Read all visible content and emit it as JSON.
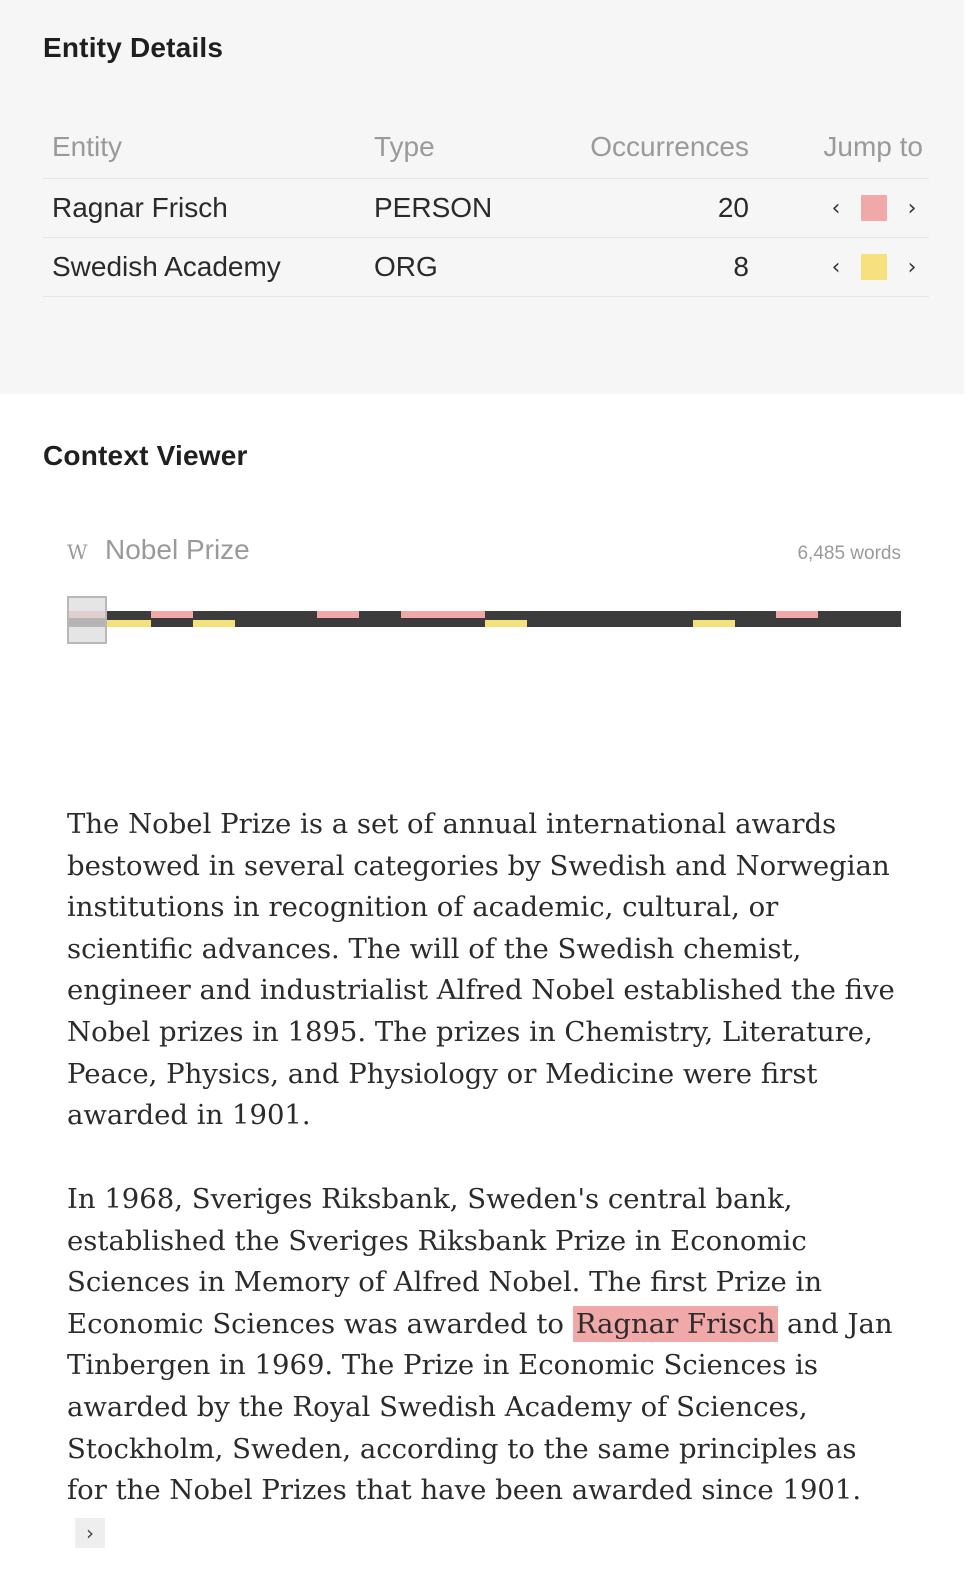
{
  "entity_details": {
    "title": "Entity Details",
    "columns": [
      "Entity",
      "Type",
      "Occurrences",
      "Jump to"
    ],
    "rows": [
      {
        "entity": "Ragnar Frisch",
        "type": "PERSON",
        "occurrences": "20",
        "color": "#f0a8a8"
      },
      {
        "entity": "Swedish Academy",
        "type": "ORG",
        "occurrences": "8",
        "color": "#f7e17e"
      }
    ],
    "prev_icon": "‹",
    "next_icon": "›"
  },
  "context_viewer": {
    "title": "Context Viewer",
    "source_icon": "W",
    "document_title": "Nobel Prize",
    "word_count": "6,485 words",
    "minimap": {
      "track_color": "#3c3c3c",
      "person_color": "#f0a8a8",
      "org_color": "#f3e27c"
    },
    "paragraph_1": "The Nobel Prize is a set of annual international awards bestowed in several categories by Swedish and Norwegian institutions in recognition of academic, cultural, or scientific advances. The will of the Swedish chemist, engineer and industrialist Alfred Nobel established the five Nobel prizes in 1895. The prizes in Chemistry, Literature, Peace, Physics, and Physiology or Medicine were first awarded in 1901.",
    "paragraph_2_before": "In 1968, Sveriges Riksbank, Sweden's central bank, established the Sveriges Riksbank Prize in Economic Sciences in Memory of Alfred Nobel. The first Prize in Economic Sciences was awarded to ",
    "paragraph_2_highlight": "Ragnar Frisch",
    "paragraph_2_after": " and Jan Tinbergen in 1969. The Prize in Economic Sciences is awarded by the Royal Swedish Academy of Sciences, Stockholm, Sweden, according to the same principles as for the Nobel Prizes that have been awarded since 1901.",
    "more_icon": "›"
  }
}
